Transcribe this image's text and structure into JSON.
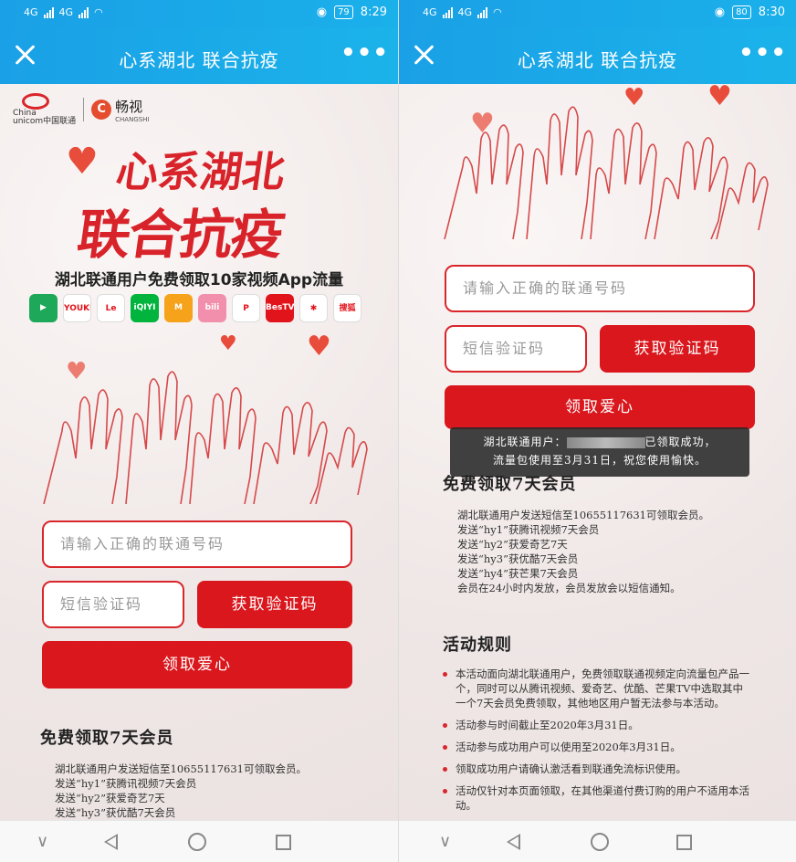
{
  "status_left": {
    "time": "8:29",
    "battery": "79",
    "signal_1": "4G",
    "signal_2": "4G"
  },
  "status_right": {
    "time": "8:30",
    "battery": "80",
    "signal_1": "4G",
    "signal_2": "4G"
  },
  "titlebar": {
    "title": "心系湖北 联合抗疫",
    "more": "•••"
  },
  "brand": {
    "unicom_line1": "China",
    "unicom_line2": "unicom中国联通",
    "changshi": "畅视",
    "changshi_sub": "CHANGSHI"
  },
  "hero": {
    "title_line1": "心系湖北",
    "title_line2": "联合抗疫",
    "subtitle": "湖北联通用户免费领取10家视频App流量"
  },
  "apps": [
    {
      "label": "▶",
      "color": "#1ea85a"
    },
    {
      "label": "YOUKU",
      "color": "#ffffff"
    },
    {
      "label": "Le",
      "color": "#ffffff"
    },
    {
      "label": "iQIYI",
      "color": "#00b43e"
    },
    {
      "label": "M",
      "color": "#f6a21a"
    },
    {
      "label": "bili",
      "color": "#f28fac"
    },
    {
      "label": "P",
      "color": "#ffffff"
    },
    {
      "label": "BesTV",
      "color": "#e1131b"
    },
    {
      "label": "✱",
      "color": "#ffffff"
    },
    {
      "label": "搜狐",
      "color": "#ffffff"
    }
  ],
  "form": {
    "phone_placeholder": "请输入正确的联通号码",
    "sms_placeholder": "短信验证码",
    "get_code": "获取验证码",
    "claim": "领取爱心"
  },
  "toast": {
    "prefix": "湖北联通用户：",
    "suffix": "已领取成功，",
    "line2": "流量包使用至3月31日，祝您使用愉快。"
  },
  "member": {
    "title": "免费领取7天会员",
    "lines": [
      "湖北联通用户发送短信至10655117631可领取会员。",
      "发送“hy1”获腾讯视频7天会员",
      "发送“hy2”获爱奇艺7天",
      "发送“hy3”获优酷7天会员",
      "发送“hy4”获芒果7天会员",
      "会员在24小时内发放，会员发放会以短信通知。"
    ]
  },
  "rules": {
    "title": "活动规则",
    "items": [
      "本活动面向湖北联通用户，免费领取联通视频定向流量包产品一个，同时可以从腾讯视频、爱奇艺、优酷、芒果TV中选取其中一个7天会员免费领取，其他地区用户暂无法参与本活动。",
      "活动参与时间截止至2020年3月31日。",
      "活动参与成功用户可以使用至2020年3月31日。",
      "领取成功用户请确认激活看到联通免流标识使用。",
      "活动仅针对本页面领取，在其他渠道付费订购的用户不适用本活动。"
    ]
  },
  "colors": {
    "accent": "#d9171d",
    "header": "#1aa0e6"
  }
}
